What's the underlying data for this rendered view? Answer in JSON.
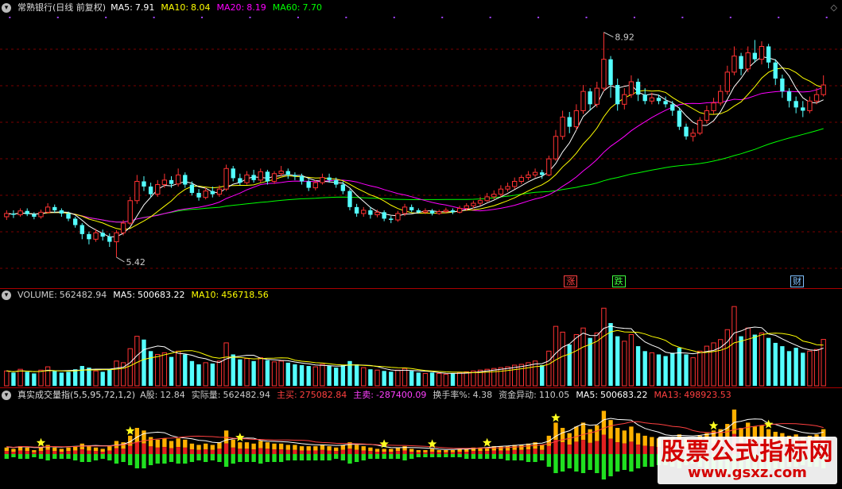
{
  "chart_data": [
    {
      "type": "candlestick",
      "title": "常熟银行(日线 前复权)",
      "indicators": [
        {
          "name": "MA5",
          "value": "7.91",
          "color": "#ffffff"
        },
        {
          "name": "MA10",
          "value": "8.04",
          "color": "#ffff00"
        },
        {
          "name": "MA20",
          "value": "8.19",
          "color": "#ff00ff"
        },
        {
          "name": "MA60",
          "value": "7.70",
          "color": "#00ff00"
        }
      ],
      "ylim": [
        5.0,
        9.2
      ],
      "high_label": "8.92",
      "low_label": "5.42",
      "candles": [
        [
          6.05,
          6.1,
          6.15,
          6.0
        ],
        [
          6.1,
          6.08,
          6.15,
          6.03
        ],
        [
          6.08,
          6.14,
          6.18,
          6.05
        ],
        [
          6.14,
          6.09,
          6.18,
          6.06
        ],
        [
          6.09,
          6.05,
          6.12,
          6.01
        ],
        [
          6.05,
          6.12,
          6.16,
          6.02
        ],
        [
          6.12,
          6.2,
          6.26,
          6.1
        ],
        [
          6.2,
          6.15,
          6.24,
          6.11
        ],
        [
          6.15,
          6.1,
          6.18,
          6.05
        ],
        [
          6.1,
          6.02,
          6.13,
          5.98
        ],
        [
          6.02,
          5.92,
          6.05,
          5.88
        ],
        [
          5.92,
          5.78,
          5.95,
          5.7
        ],
        [
          5.78,
          5.7,
          5.82,
          5.62
        ],
        [
          5.7,
          5.8,
          5.86,
          5.66
        ],
        [
          5.8,
          5.74,
          5.85,
          5.68
        ],
        [
          5.74,
          5.66,
          5.79,
          5.58
        ],
        [
          5.66,
          5.8,
          5.84,
          5.42
        ],
        [
          5.8,
          5.95,
          6.0,
          5.76
        ],
        [
          5.95,
          6.3,
          6.36,
          5.92
        ],
        [
          6.3,
          6.6,
          6.7,
          6.25
        ],
        [
          6.6,
          6.52,
          6.68,
          6.45
        ],
        [
          6.52,
          6.4,
          6.58,
          6.35
        ],
        [
          6.4,
          6.55,
          6.62,
          6.36
        ],
        [
          6.55,
          6.62,
          6.72,
          6.5
        ],
        [
          6.62,
          6.56,
          6.68,
          6.5
        ],
        [
          6.56,
          6.7,
          6.8,
          6.52
        ],
        [
          6.7,
          6.55,
          6.74,
          6.5
        ],
        [
          6.55,
          6.42,
          6.6,
          6.38
        ],
        [
          6.42,
          6.35,
          6.48,
          6.3
        ],
        [
          6.35,
          6.45,
          6.5,
          6.32
        ],
        [
          6.45,
          6.4,
          6.52,
          6.35
        ],
        [
          6.4,
          6.48,
          6.54,
          6.36
        ],
        [
          6.48,
          6.8,
          6.86,
          6.45
        ],
        [
          6.8,
          6.65,
          6.84,
          6.6
        ],
        [
          6.65,
          6.58,
          6.72,
          6.54
        ],
        [
          6.58,
          6.7,
          6.76,
          6.55
        ],
        [
          6.7,
          6.62,
          6.78,
          6.58
        ],
        [
          6.62,
          6.75,
          6.8,
          6.58
        ],
        [
          6.75,
          6.6,
          6.78,
          6.55
        ],
        [
          6.6,
          6.72,
          6.76,
          6.56
        ],
        [
          6.72,
          6.76,
          6.84,
          6.68
        ],
        [
          6.76,
          6.7,
          6.8,
          6.64
        ],
        [
          6.7,
          6.68,
          6.74,
          6.62
        ],
        [
          6.68,
          6.6,
          6.72,
          6.55
        ],
        [
          6.6,
          6.5,
          6.64,
          6.45
        ],
        [
          6.5,
          6.58,
          6.62,
          6.46
        ],
        [
          6.58,
          6.66,
          6.72,
          6.55
        ],
        [
          6.66,
          6.62,
          6.72,
          6.58
        ],
        [
          6.62,
          6.55,
          6.66,
          6.5
        ],
        [
          6.55,
          6.45,
          6.6,
          6.4
        ],
        [
          6.45,
          6.2,
          6.48,
          6.15
        ],
        [
          6.2,
          6.1,
          6.25,
          6.05
        ],
        [
          6.1,
          6.15,
          6.2,
          6.05
        ],
        [
          6.15,
          6.08,
          6.2,
          6.02
        ],
        [
          6.08,
          6.12,
          6.16,
          6.04
        ],
        [
          6.12,
          6.02,
          6.15,
          5.98
        ],
        [
          6.02,
          6.0,
          6.06,
          5.95
        ],
        [
          6.0,
          6.1,
          6.14,
          5.97
        ],
        [
          6.1,
          6.2,
          6.25,
          6.06
        ],
        [
          6.2,
          6.15,
          6.24,
          6.12
        ],
        [
          6.15,
          6.12,
          6.18,
          6.1
        ],
        [
          6.12,
          6.14,
          6.18,
          6.09
        ],
        [
          6.14,
          6.1,
          6.17,
          6.07
        ],
        [
          6.1,
          6.13,
          6.16,
          6.08
        ],
        [
          6.13,
          6.15,
          6.19,
          6.1
        ],
        [
          6.15,
          6.12,
          6.18,
          6.09
        ],
        [
          6.12,
          6.18,
          6.22,
          6.1
        ],
        [
          6.18,
          6.22,
          6.26,
          6.14
        ],
        [
          6.22,
          6.26,
          6.3,
          6.18
        ],
        [
          6.26,
          6.3,
          6.36,
          6.22
        ],
        [
          6.3,
          6.36,
          6.42,
          6.28
        ],
        [
          6.36,
          6.4,
          6.46,
          6.32
        ],
        [
          6.4,
          6.48,
          6.54,
          6.36
        ],
        [
          6.48,
          6.52,
          6.58,
          6.44
        ],
        [
          6.52,
          6.6,
          6.66,
          6.48
        ],
        [
          6.6,
          6.66,
          6.7,
          6.56
        ],
        [
          6.66,
          6.7,
          6.76,
          6.62
        ],
        [
          6.7,
          6.74,
          6.8,
          6.66
        ],
        [
          6.74,
          6.7,
          6.78,
          6.64
        ],
        [
          6.7,
          6.95,
          7.0,
          6.68
        ],
        [
          6.95,
          7.3,
          7.4,
          6.92
        ],
        [
          7.3,
          7.6,
          7.7,
          7.25
        ],
        [
          7.6,
          7.45,
          7.68,
          7.35
        ],
        [
          7.45,
          7.7,
          7.8,
          7.4
        ],
        [
          7.7,
          8.0,
          8.1,
          7.65
        ],
        [
          8.0,
          7.8,
          8.05,
          7.7
        ],
        [
          7.8,
          8.05,
          8.15,
          7.75
        ],
        [
          8.05,
          8.5,
          8.92,
          8.0
        ],
        [
          8.5,
          8.1,
          8.55,
          7.9
        ],
        [
          8.1,
          7.8,
          8.2,
          7.7
        ],
        [
          7.8,
          7.95,
          8.05,
          7.72
        ],
        [
          7.95,
          8.15,
          8.25,
          7.9
        ],
        [
          8.15,
          7.95,
          8.2,
          7.85
        ],
        [
          7.95,
          7.85,
          8.05,
          7.8
        ],
        [
          7.85,
          7.9,
          7.98,
          7.8
        ],
        [
          7.9,
          7.85,
          7.95,
          7.8
        ],
        [
          7.85,
          7.8,
          7.92,
          7.75
        ],
        [
          7.8,
          7.7,
          7.85,
          7.62
        ],
        [
          7.7,
          7.45,
          7.75,
          7.4
        ],
        [
          7.45,
          7.3,
          7.5,
          7.25
        ],
        [
          7.3,
          7.35,
          7.42,
          7.22
        ],
        [
          7.35,
          7.55,
          7.6,
          7.32
        ],
        [
          7.55,
          7.7,
          7.78,
          7.5
        ],
        [
          7.7,
          7.82,
          7.9,
          7.65
        ],
        [
          7.82,
          8.0,
          8.1,
          7.78
        ],
        [
          8.0,
          8.3,
          8.4,
          7.95
        ],
        [
          8.3,
          8.55,
          8.7,
          8.25
        ],
        [
          8.55,
          8.35,
          8.6,
          8.25
        ],
        [
          8.35,
          8.6,
          8.7,
          8.3
        ],
        [
          8.6,
          8.5,
          8.8,
          8.45
        ],
        [
          8.5,
          8.7,
          8.78,
          8.42
        ],
        [
          8.7,
          8.45,
          8.74,
          8.36
        ],
        [
          8.45,
          8.2,
          8.5,
          8.1
        ],
        [
          8.2,
          8.0,
          8.26,
          7.9
        ],
        [
          8.0,
          7.85,
          8.05,
          7.75
        ],
        [
          7.85,
          7.75,
          7.92,
          7.66
        ],
        [
          7.75,
          7.7,
          7.85,
          7.6
        ],
        [
          7.7,
          7.85,
          7.92,
          7.66
        ],
        [
          7.85,
          7.95,
          8.05,
          7.8
        ],
        [
          7.95,
          8.1,
          8.25,
          7.92
        ]
      ],
      "markers": [
        {
          "label": "涨",
          "color": "#ff4040"
        },
        {
          "label": "跌",
          "color": "#40ff40"
        },
        {
          "label": "财",
          "color": "#80c0ff"
        }
      ]
    },
    {
      "type": "bar",
      "title": "VOLUME",
      "indicators": [
        {
          "name": "VOLUME",
          "value": "562482.94",
          "color": "#cccccc"
        },
        {
          "name": "MA5",
          "value": "500683.22",
          "color": "#ffffff"
        },
        {
          "name": "MA10",
          "value": "456718.56",
          "color": "#ffff00"
        }
      ],
      "ylim": [
        0,
        1000000
      ],
      "values": [
        180000,
        160000,
        200000,
        170000,
        150000,
        190000,
        230000,
        180000,
        160000,
        170000,
        200000,
        240000,
        220000,
        180000,
        170000,
        200000,
        300000,
        280000,
        450000,
        600000,
        560000,
        420000,
        380000,
        400000,
        350000,
        420000,
        380000,
        300000,
        260000,
        280000,
        270000,
        300000,
        520000,
        380000,
        320000,
        330000,
        300000,
        340000,
        310000,
        290000,
        300000,
        280000,
        260000,
        250000,
        240000,
        230000,
        260000,
        240000,
        220000,
        250000,
        300000,
        260000,
        220000,
        200000,
        190000,
        180000,
        170000,
        190000,
        210000,
        180000,
        160000,
        150000,
        160000,
        150000,
        140000,
        150000,
        160000,
        170000,
        180000,
        190000,
        200000,
        210000,
        220000,
        230000,
        250000,
        260000,
        280000,
        300000,
        250000,
        420000,
        720000,
        650000,
        500000,
        620000,
        700000,
        580000,
        640000,
        940000,
        760000,
        600000,
        540000,
        620000,
        480000,
        420000,
        400000,
        380000,
        360000,
        400000,
        460000,
        380000,
        340000,
        420000,
        480000,
        520000,
        560000,
        680000,
        960000,
        600000,
        700000,
        620000,
        640000,
        580000,
        520000,
        480000,
        420000,
        460000,
        400000,
        420000,
        440000,
        562000
      ]
    },
    {
      "type": "bar",
      "title": "真实成交量指(5,5,95,72,1,2)",
      "indicators": [
        {
          "name": "A股",
          "value": "12.84",
          "color": "#cccccc"
        },
        {
          "name": "实际量",
          "value": "562482.94",
          "color": "#cccccc"
        },
        {
          "name": "主买",
          "value": "275082.84",
          "color": "#ff4040"
        },
        {
          "name": "主卖",
          "value": "-287400.09",
          "color": "#ff40ff"
        },
        {
          "name": "换手率%",
          "value": "4.38",
          "color": "#cccccc"
        },
        {
          "name": "资金异动",
          "value": "110.05",
          "color": "#cccccc"
        },
        {
          "name": "MA5",
          "value": "500683.22",
          "color": "#ffffff"
        },
        {
          "name": "MA13",
          "value": "498923.53",
          "color": "#ff4040"
        }
      ],
      "pos_values": [
        5,
        4,
        6,
        5,
        3,
        5,
        7,
        5,
        4,
        5,
        6,
        8,
        6,
        5,
        4,
        6,
        10,
        9,
        14,
        20,
        18,
        13,
        11,
        12,
        10,
        12,
        11,
        8,
        7,
        8,
        7,
        9,
        18,
        11,
        9,
        9,
        8,
        10,
        9,
        8,
        8,
        7,
        7,
        6,
        6,
        6,
        7,
        6,
        5,
        7,
        9,
        7,
        6,
        5,
        4,
        4,
        4,
        5,
        6,
        4,
        3,
        3,
        4,
        3,
        3,
        3,
        4,
        4,
        5,
        5,
        5,
        6,
        6,
        6,
        7,
        7,
        8,
        9,
        7,
        14,
        24,
        20,
        16,
        21,
        24,
        19,
        22,
        33,
        26,
        20,
        18,
        21,
        16,
        14,
        13,
        12,
        12,
        13,
        15,
        12,
        11,
        14,
        16,
        18,
        19,
        23,
        34,
        20,
        24,
        21,
        22,
        19,
        17,
        16,
        14,
        15,
        13,
        14,
        15,
        19
      ],
      "neg_values": [
        3,
        2,
        3,
        3,
        2,
        3,
        4,
        3,
        3,
        3,
        4,
        5,
        5,
        4,
        3,
        4,
        6,
        5,
        7,
        9,
        9,
        7,
        6,
        6,
        5,
        6,
        6,
        5,
        4,
        5,
        4,
        5,
        8,
        6,
        5,
        5,
        5,
        6,
        5,
        5,
        5,
        4,
        4,
        4,
        4,
        4,
        4,
        4,
        3,
        4,
        6,
        5,
        4,
        3,
        3,
        3,
        3,
        3,
        4,
        3,
        2,
        2,
        2,
        2,
        2,
        2,
        2,
        3,
        3,
        3,
        3,
        3,
        3,
        4,
        4,
        4,
        5,
        5,
        4,
        8,
        12,
        11,
        9,
        11,
        12,
        10,
        12,
        16,
        14,
        11,
        10,
        11,
        9,
        8,
        8,
        7,
        7,
        8,
        9,
        7,
        6,
        8,
        9,
        10,
        10,
        12,
        16,
        11,
        12,
        11,
        11,
        10,
        9,
        9,
        8,
        8,
        7,
        8,
        8,
        9
      ],
      "ylim": [
        -20,
        40
      ]
    }
  ],
  "watermark": {
    "title": "股票公式指标网",
    "url": "www.gsxz.com"
  }
}
